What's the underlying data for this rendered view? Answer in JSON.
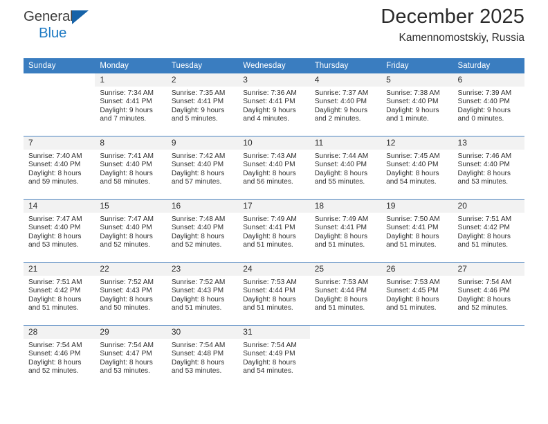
{
  "brand": {
    "name_part1": "General",
    "name_part2": "Blue",
    "triangle_color": "#1663a8",
    "blue_color": "#1f7bc4"
  },
  "header": {
    "month_title": "December 2025",
    "location": "Kamennomostskiy, Russia"
  },
  "theme": {
    "header_bar_color": "#3a7dc0",
    "daynum_band_color": "#f2f2f2",
    "text_color": "#2b2b2b"
  },
  "weekday_headers": [
    "Sunday",
    "Monday",
    "Tuesday",
    "Wednesday",
    "Thursday",
    "Friday",
    "Saturday"
  ],
  "labels": {
    "sunrise_prefix": "Sunrise: ",
    "sunset_prefix": "Sunset: ",
    "daylight_prefix": "Daylight: "
  },
  "weeks": [
    [
      {
        "day": "",
        "blank": true
      },
      {
        "day": "1",
        "sunrise": "Sunrise: 7:34 AM",
        "sunset": "Sunset: 4:41 PM",
        "daylight_line1": "Daylight: 9 hours",
        "daylight_line2": "and 7 minutes."
      },
      {
        "day": "2",
        "sunrise": "Sunrise: 7:35 AM",
        "sunset": "Sunset: 4:41 PM",
        "daylight_line1": "Daylight: 9 hours",
        "daylight_line2": "and 5 minutes."
      },
      {
        "day": "3",
        "sunrise": "Sunrise: 7:36 AM",
        "sunset": "Sunset: 4:41 PM",
        "daylight_line1": "Daylight: 9 hours",
        "daylight_line2": "and 4 minutes."
      },
      {
        "day": "4",
        "sunrise": "Sunrise: 7:37 AM",
        "sunset": "Sunset: 4:40 PM",
        "daylight_line1": "Daylight: 9 hours",
        "daylight_line2": "and 2 minutes."
      },
      {
        "day": "5",
        "sunrise": "Sunrise: 7:38 AM",
        "sunset": "Sunset: 4:40 PM",
        "daylight_line1": "Daylight: 9 hours",
        "daylight_line2": "and 1 minute."
      },
      {
        "day": "6",
        "sunrise": "Sunrise: 7:39 AM",
        "sunset": "Sunset: 4:40 PM",
        "daylight_line1": "Daylight: 9 hours",
        "daylight_line2": "and 0 minutes."
      }
    ],
    [
      {
        "day": "7",
        "sunrise": "Sunrise: 7:40 AM",
        "sunset": "Sunset: 4:40 PM",
        "daylight_line1": "Daylight: 8 hours",
        "daylight_line2": "and 59 minutes."
      },
      {
        "day": "8",
        "sunrise": "Sunrise: 7:41 AM",
        "sunset": "Sunset: 4:40 PM",
        "daylight_line1": "Daylight: 8 hours",
        "daylight_line2": "and 58 minutes."
      },
      {
        "day": "9",
        "sunrise": "Sunrise: 7:42 AM",
        "sunset": "Sunset: 4:40 PM",
        "daylight_line1": "Daylight: 8 hours",
        "daylight_line2": "and 57 minutes."
      },
      {
        "day": "10",
        "sunrise": "Sunrise: 7:43 AM",
        "sunset": "Sunset: 4:40 PM",
        "daylight_line1": "Daylight: 8 hours",
        "daylight_line2": "and 56 minutes."
      },
      {
        "day": "11",
        "sunrise": "Sunrise: 7:44 AM",
        "sunset": "Sunset: 4:40 PM",
        "daylight_line1": "Daylight: 8 hours",
        "daylight_line2": "and 55 minutes."
      },
      {
        "day": "12",
        "sunrise": "Sunrise: 7:45 AM",
        "sunset": "Sunset: 4:40 PM",
        "daylight_line1": "Daylight: 8 hours",
        "daylight_line2": "and 54 minutes."
      },
      {
        "day": "13",
        "sunrise": "Sunrise: 7:46 AM",
        "sunset": "Sunset: 4:40 PM",
        "daylight_line1": "Daylight: 8 hours",
        "daylight_line2": "and 53 minutes."
      }
    ],
    [
      {
        "day": "14",
        "sunrise": "Sunrise: 7:47 AM",
        "sunset": "Sunset: 4:40 PM",
        "daylight_line1": "Daylight: 8 hours",
        "daylight_line2": "and 53 minutes."
      },
      {
        "day": "15",
        "sunrise": "Sunrise: 7:47 AM",
        "sunset": "Sunset: 4:40 PM",
        "daylight_line1": "Daylight: 8 hours",
        "daylight_line2": "and 52 minutes."
      },
      {
        "day": "16",
        "sunrise": "Sunrise: 7:48 AM",
        "sunset": "Sunset: 4:40 PM",
        "daylight_line1": "Daylight: 8 hours",
        "daylight_line2": "and 52 minutes."
      },
      {
        "day": "17",
        "sunrise": "Sunrise: 7:49 AM",
        "sunset": "Sunset: 4:41 PM",
        "daylight_line1": "Daylight: 8 hours",
        "daylight_line2": "and 51 minutes."
      },
      {
        "day": "18",
        "sunrise": "Sunrise: 7:49 AM",
        "sunset": "Sunset: 4:41 PM",
        "daylight_line1": "Daylight: 8 hours",
        "daylight_line2": "and 51 minutes."
      },
      {
        "day": "19",
        "sunrise": "Sunrise: 7:50 AM",
        "sunset": "Sunset: 4:41 PM",
        "daylight_line1": "Daylight: 8 hours",
        "daylight_line2": "and 51 minutes."
      },
      {
        "day": "20",
        "sunrise": "Sunrise: 7:51 AM",
        "sunset": "Sunset: 4:42 PM",
        "daylight_line1": "Daylight: 8 hours",
        "daylight_line2": "and 51 minutes."
      }
    ],
    [
      {
        "day": "21",
        "sunrise": "Sunrise: 7:51 AM",
        "sunset": "Sunset: 4:42 PM",
        "daylight_line1": "Daylight: 8 hours",
        "daylight_line2": "and 51 minutes."
      },
      {
        "day": "22",
        "sunrise": "Sunrise: 7:52 AM",
        "sunset": "Sunset: 4:43 PM",
        "daylight_line1": "Daylight: 8 hours",
        "daylight_line2": "and 50 minutes."
      },
      {
        "day": "23",
        "sunrise": "Sunrise: 7:52 AM",
        "sunset": "Sunset: 4:43 PM",
        "daylight_line1": "Daylight: 8 hours",
        "daylight_line2": "and 51 minutes."
      },
      {
        "day": "24",
        "sunrise": "Sunrise: 7:53 AM",
        "sunset": "Sunset: 4:44 PM",
        "daylight_line1": "Daylight: 8 hours",
        "daylight_line2": "and 51 minutes."
      },
      {
        "day": "25",
        "sunrise": "Sunrise: 7:53 AM",
        "sunset": "Sunset: 4:44 PM",
        "daylight_line1": "Daylight: 8 hours",
        "daylight_line2": "and 51 minutes."
      },
      {
        "day": "26",
        "sunrise": "Sunrise: 7:53 AM",
        "sunset": "Sunset: 4:45 PM",
        "daylight_line1": "Daylight: 8 hours",
        "daylight_line2": "and 51 minutes."
      },
      {
        "day": "27",
        "sunrise": "Sunrise: 7:54 AM",
        "sunset": "Sunset: 4:46 PM",
        "daylight_line1": "Daylight: 8 hours",
        "daylight_line2": "and 52 minutes."
      }
    ],
    [
      {
        "day": "28",
        "sunrise": "Sunrise: 7:54 AM",
        "sunset": "Sunset: 4:46 PM",
        "daylight_line1": "Daylight: 8 hours",
        "daylight_line2": "and 52 minutes."
      },
      {
        "day": "29",
        "sunrise": "Sunrise: 7:54 AM",
        "sunset": "Sunset: 4:47 PM",
        "daylight_line1": "Daylight: 8 hours",
        "daylight_line2": "and 53 minutes."
      },
      {
        "day": "30",
        "sunrise": "Sunrise: 7:54 AM",
        "sunset": "Sunset: 4:48 PM",
        "daylight_line1": "Daylight: 8 hours",
        "daylight_line2": "and 53 minutes."
      },
      {
        "day": "31",
        "sunrise": "Sunrise: 7:54 AM",
        "sunset": "Sunset: 4:49 PM",
        "daylight_line1": "Daylight: 8 hours",
        "daylight_line2": "and 54 minutes."
      },
      {
        "day": "",
        "blank": true
      },
      {
        "day": "",
        "blank": true
      },
      {
        "day": "",
        "blank": true
      }
    ]
  ]
}
